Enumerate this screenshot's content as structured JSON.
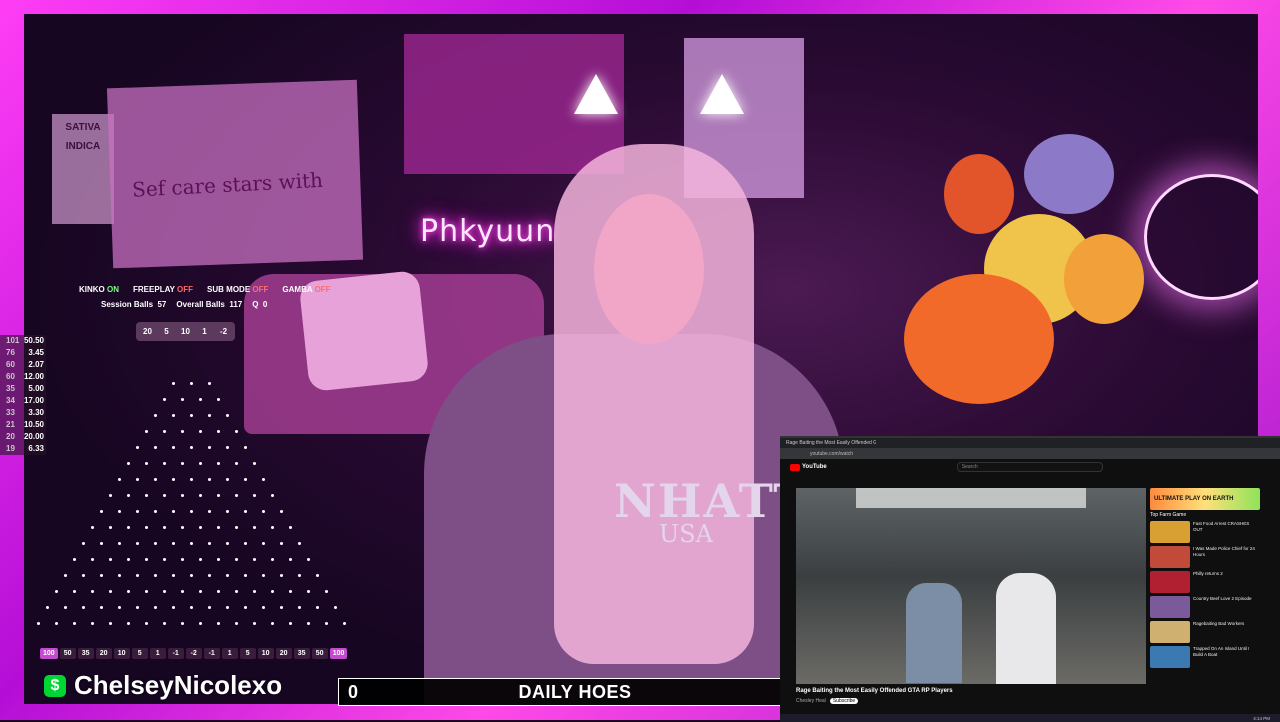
{
  "hud": {
    "status": [
      {
        "label": "KINKO",
        "state": "ON"
      },
      {
        "label": "FREEPLAY",
        "state": "OFF"
      },
      {
        "label": "SUB MODE",
        "state": "OFF"
      },
      {
        "label": "GAMBA",
        "state": "OFF"
      }
    ],
    "session_balls_label": "Session Balls",
    "session_balls": "57",
    "overall_balls_label": "Overall Balls",
    "overall_balls": "117",
    "queue_label": "Q",
    "queue": "0",
    "chips": [
      "20",
      "5",
      "10",
      "1",
      "-2"
    ],
    "multipliers": [
      {
        "a": "101",
        "b": "50.50"
      },
      {
        "a": "76",
        "b": "3.45"
      },
      {
        "a": "60",
        "b": "2.07"
      },
      {
        "a": "60",
        "b": "12.00"
      },
      {
        "a": "35",
        "b": "5.00"
      },
      {
        "a": "34",
        "b": "17.00"
      },
      {
        "a": "33",
        "b": "3.30"
      },
      {
        "a": "21",
        "b": "10.50"
      },
      {
        "a": "20",
        "b": "20.00"
      },
      {
        "a": "19",
        "b": "6.33"
      }
    ],
    "slots": [
      "100",
      "50",
      "35",
      "20",
      "10",
      "5",
      "1",
      "-1",
      "-2",
      "-1",
      "1",
      "5",
      "10",
      "20",
      "35",
      "50",
      "100"
    ]
  },
  "room": {
    "poster_text": "Sef care stars with",
    "sign_text_1": "SATIVA",
    "sign_text_2": "INDICA",
    "neon_text": "Phkyuun",
    "shirt_text": "NHATT",
    "shirt_sub": "USA"
  },
  "handle": {
    "cash_symbol": "$",
    "name": "ChelseyNicolexo"
  },
  "bottom_bar": {
    "count": "0",
    "title": "DAILY HOES"
  },
  "browser": {
    "tab_title": "Rage Baiting the Most Easily Offended GTA RP Players",
    "address": "youtube.com/watch",
    "brand": "YouTube",
    "search_placeholder": "Search",
    "video_title": "Rage Baiting the Most Easily Offended GTA RP Players",
    "channel": "Chesley Heal",
    "subscribe": "Subscribe",
    "promo_title": "ULTIMATE PLAY ON EARTH",
    "promo_game": "Top Farm Game",
    "recommendations": [
      "Fast Food Arrest CRASHES OUT",
      "I Was Made Police Chief for 24 Hours",
      "Philly returns 2",
      "Country Beef Love 2 Episode",
      "Ragebaiting Bad Workers",
      "Trapped On An Island Until I Build A Boat"
    ],
    "taskbar_time": "4:14 PM"
  }
}
